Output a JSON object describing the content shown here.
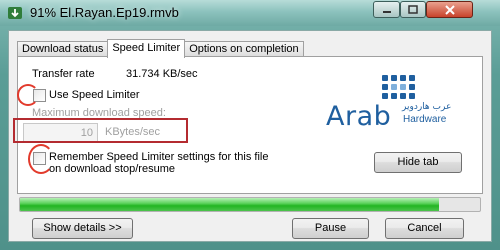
{
  "window": {
    "title": "91% El.Rayan.Ep19.rmvb"
  },
  "tabs": [
    {
      "label": "Download status",
      "active": false
    },
    {
      "label": "Speed Limiter",
      "active": true
    },
    {
      "label": "Options on completion",
      "active": false
    }
  ],
  "speed_limiter": {
    "transfer_rate_label": "Transfer rate",
    "transfer_rate_value": "31.734  KB/sec",
    "use_speed_limiter_label": "Use Speed Limiter",
    "use_speed_limiter_checked": false,
    "max_download_speed_label": "Maximum download speed:",
    "max_speed_value": "10",
    "max_speed_unit": "KBytes/sec",
    "remember_label_line1": "Remember Speed Limiter settings for this file",
    "remember_label_line2": "on download stop/resume",
    "remember_checked": false
  },
  "logo": {
    "name": "Arab",
    "subtitle": "Hardware",
    "arabic": "عرب هاردوير"
  },
  "buttons": {
    "hide_tab": "Hide tab",
    "show_details": "Show details >>",
    "pause": "Pause",
    "cancel": "Cancel"
  },
  "progress": {
    "percent": 91
  },
  "colors": {
    "accent_red": "#e23a2c",
    "logo_blue": "#1f5f9f",
    "progress_green": "#22b522"
  }
}
